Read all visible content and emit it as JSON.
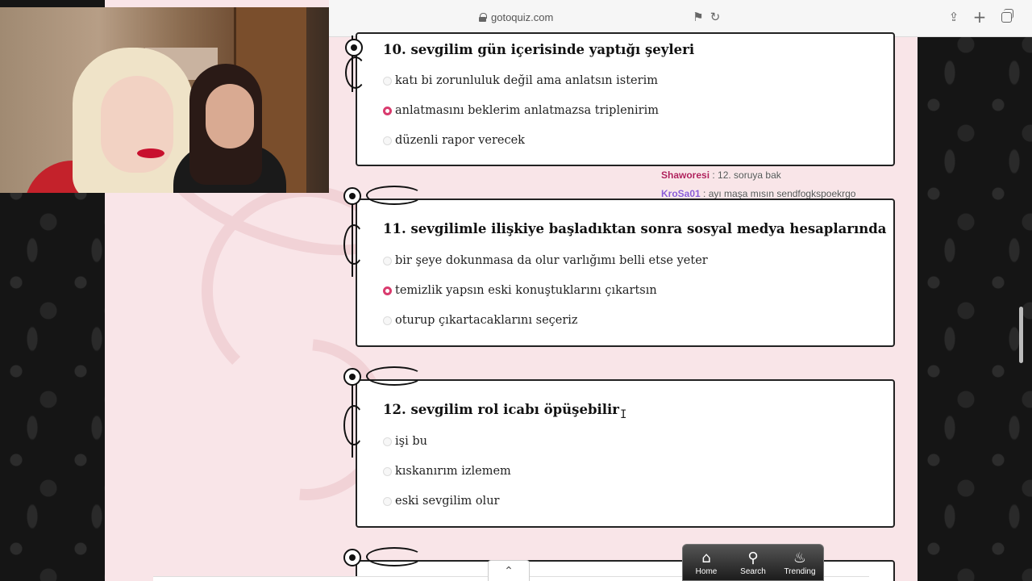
{
  "browser": {
    "url": "gotoquiz.com"
  },
  "chat": [
    {
      "user": "Shaworesi",
      "message": " : 12. soruya bak",
      "color": "#b0205a"
    },
    {
      "user": "KroSa01",
      "message": " : ayı maşa mısın sendfogkspoekrgo",
      "color": "#8b5cd6"
    }
  ],
  "questions": [
    {
      "title": "10. sevgilim gün içerisinde yaptığı şeyleri",
      "options": [
        {
          "label": "katı bi zorunluluk değil ama anlatsın isterim",
          "selected": false
        },
        {
          "label": "anlatmasını beklerim anlatmazsa triplenirim",
          "selected": true
        },
        {
          "label": "düzenli rapor verecek",
          "selected": false
        }
      ]
    },
    {
      "title": "11. sevgilimle ilişkiye başladıktan sonra sosyal medya hesaplarında",
      "options": [
        {
          "label": "bir şeye dokunmasa da olur varlığımı belli etse yeter",
          "selected": false
        },
        {
          "label": "temizlik yapsın eski konuştuklarını çıkartsın",
          "selected": true
        },
        {
          "label": "oturup çıkartacaklarını seçeriz",
          "selected": false
        }
      ]
    },
    {
      "title": "12. sevgilim rol icabı öpüşebilir",
      "options": [
        {
          "label": "işi bu",
          "selected": false
        },
        {
          "label": "kıskanırım izlemem",
          "selected": false
        },
        {
          "label": "eski sevgilim olur",
          "selected": false
        }
      ]
    }
  ],
  "bottom_nav": {
    "home": "Home",
    "search": "Search",
    "trending": "Trending"
  },
  "colors": {
    "accent_radio": "#d93b6e",
    "page_bg": "#f9e5e8"
  }
}
